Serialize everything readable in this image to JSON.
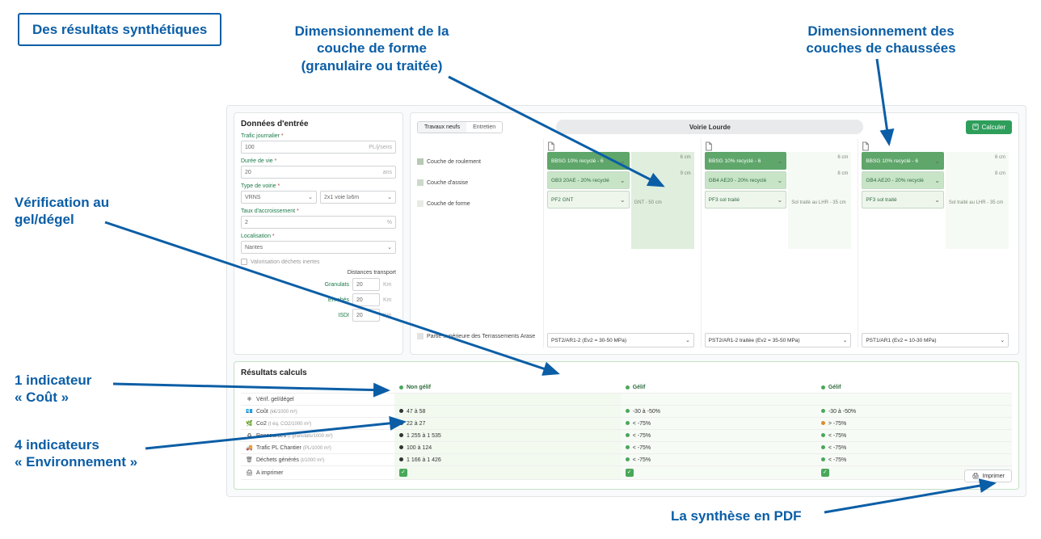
{
  "annotations": {
    "title": "Des résultats synthétiques",
    "couche_forme_l1": "Dimensionnement de la",
    "couche_forme_l2": "couche de forme",
    "couche_forme_l3": "(granulaire ou traitée)",
    "chaussees_l1": "Dimensionnement des",
    "chaussees_l2": "couches de chaussées",
    "gel_l1": "Vérification au",
    "gel_l2": "gel/dégel",
    "cout_l1": "1 indicateur",
    "cout_l2": "« Coût »",
    "env_l1": "4 indicateurs",
    "env_l2": "« Environnement »",
    "pdf": "La synthèse en PDF"
  },
  "inputs": {
    "title": "Données d'entrée",
    "trafic_label": "Trafic journalier",
    "trafic_value": "100",
    "trafic_unit": "PL/j/sens",
    "duree_label": "Durée de vie",
    "duree_value": "20",
    "duree_unit": "ans",
    "type_label": "Type de voirie",
    "type_value": "VRNS",
    "type_lane": "2x1 voie l≥6m",
    "taux_label": "Taux d'accroissement",
    "taux_value": "2",
    "taux_unit": "%",
    "loc_label": "Localisation",
    "loc_value": "Nantes",
    "valo_label": "Valorisation déchets inertes",
    "distances_title": "Distances transport",
    "dist1_label": "Granulats",
    "dist1_value": "20",
    "dist2_label": "Enrobés",
    "dist2_value": "20",
    "dist3_label": "ISDI",
    "dist3_value": "20",
    "dist_unit": "Km"
  },
  "main": {
    "tab1": "Travaux neufs",
    "tab2": "Entretien",
    "pill": "Voirie Lourde",
    "calc": "Calculer",
    "layers": {
      "l1": "Couche de roulement",
      "l2": "Couche d'assise",
      "l3": "Couche de forme",
      "l4": "Partie supérieure des Terrassements Arase"
    },
    "variants": [
      {
        "roul": "BBSG 10% recyclé - 6",
        "assise": "GB3 20AE - 20% recyclé",
        "forme": "PF2 GNT",
        "vis_top": "6 cm",
        "vis_mid": "9 cm",
        "vis_form": "GNT - 50 cm",
        "pst": "PST2/AR1-2 (Ev2 = 30-50 MPa)"
      },
      {
        "roul": "BBSG 10% recyclé - 6",
        "assise": "GB4 AE20 - 20% recyclé",
        "forme": "PF3 sol traité",
        "vis_top": "6 cm",
        "vis_mid": "8 cm",
        "vis_form": "Sol traité au LHR - 35 cm",
        "pst": "PST2/AR1-2 traitée (Ev2 = 35-50 MPa)"
      },
      {
        "roul": "BBSG 10% recyclé - 6",
        "assise": "GB4 AE20 - 20% recyclé",
        "forme": "PF3 sol traité",
        "vis_top": "6 cm",
        "vis_mid": "8 cm",
        "vis_form": "Sol traité au LHR - 35 cm",
        "pst": "PST1/AR1 (Ev2 = 10-30 MPa)"
      }
    ]
  },
  "results": {
    "title": "Résultats calculs",
    "headers": [
      "Non gélif",
      "Gélif",
      "Gélif"
    ],
    "rows": [
      {
        "icon": "❄",
        "label": "Vérif. gel/dégel",
        "sub": "",
        "v": [
          "",
          "",
          ""
        ]
      },
      {
        "icon": "💶",
        "label": "Coût",
        "sub": "(k€/1000 m²)",
        "v": [
          "47 à 58",
          "-30 à -50%",
          "-30 à -50%"
        ],
        "dot": [
          "k",
          "g",
          "g"
        ]
      },
      {
        "icon": "🌿",
        "label": "Co2",
        "sub": "(t éq. CO2/1000 m²)",
        "v": [
          "22 à 27",
          "< -75%",
          "> -75%"
        ],
        "dot": [
          "k",
          "g",
          "o"
        ]
      },
      {
        "icon": "♻",
        "label": "Ressources",
        "sub": "(t granulats/1000 m²)",
        "v": [
          "1 255 à 1 535",
          "< -75%",
          "< -75%"
        ],
        "dot": [
          "k",
          "g",
          "g"
        ]
      },
      {
        "icon": "🚚",
        "label": "Trafic PL Chantier",
        "sub": "(PL/1000 m²)",
        "v": [
          "100 à 124",
          "< -75%",
          "< -75%"
        ],
        "dot": [
          "k",
          "g",
          "g"
        ]
      },
      {
        "icon": "🗑",
        "label": "Déchets générés",
        "sub": "(t/1000 m²)",
        "v": [
          "1 166 à 1 426",
          "< -75%",
          "< -75%"
        ],
        "dot": [
          "k",
          "g",
          "g"
        ]
      },
      {
        "icon": "🖨",
        "label": "A imprimer",
        "sub": "",
        "v": [
          "✓",
          "✓",
          "✓"
        ],
        "check": true
      }
    ],
    "print": "Imprimer"
  }
}
